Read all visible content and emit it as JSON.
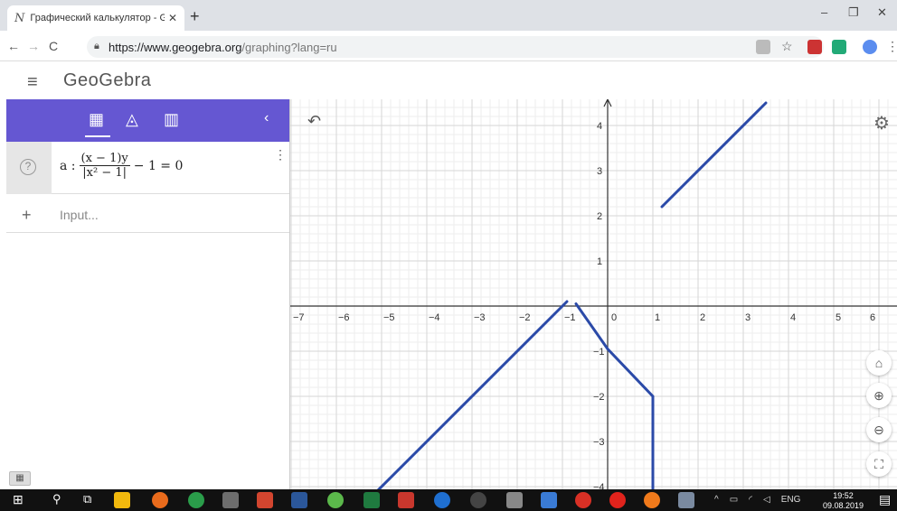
{
  "browser": {
    "tab_title": "Графический калькулятор - Geo",
    "tab_icon": "N",
    "new_tab": "+",
    "url_host": "https://www.geogebra.org",
    "url_path": "/graphing?lang=ru",
    "win_min": "–",
    "win_max": "❐",
    "win_close": "✕"
  },
  "app": {
    "logo": "GeoGebra",
    "menu_icon": "hamburger-icon"
  },
  "algebra": {
    "tools": [
      "calculator-icon",
      "geometry-icon",
      "table-icon"
    ],
    "collapse": "‹",
    "row1": {
      "help": "?",
      "prefix": "a :",
      "numerator": "(x − 1)y",
      "denominator": "|x² − 1|",
      "suffix": "− 1 = 0",
      "menu": "⋮"
    },
    "input_placeholder": "Input...",
    "add_icon": "+"
  },
  "graph": {
    "x_ticks": [
      "−7",
      "−6",
      "−5",
      "−4",
      "−3",
      "−2",
      "−1",
      "0",
      "1",
      "2",
      "3",
      "4",
      "5",
      "6"
    ],
    "y_ticks_pos": [
      "4",
      "3",
      "2",
      "1"
    ],
    "y_ticks_neg": [
      "−1",
      "−2",
      "−3",
      "−4"
    ],
    "curve_label": "a",
    "curve_color": "#2b4aa8",
    "buttons": {
      "home": "⌂",
      "zoom_in": "⊕",
      "zoom_out": "⊖",
      "fullscreen": "⛶"
    }
  },
  "taskbar": {
    "lang": "ENG",
    "time": "19:52",
    "date": "09.08.2019"
  }
}
